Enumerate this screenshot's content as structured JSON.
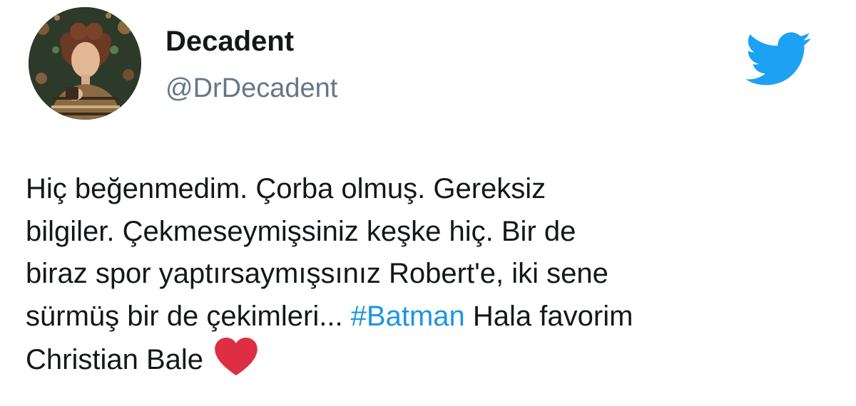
{
  "user": {
    "display_name": "Decadent",
    "handle": "@DrDecadent"
  },
  "icons": {
    "avatar": "profile-photo",
    "logo": "twitter-bird-icon",
    "emoji": "red-heart-icon"
  },
  "colors": {
    "text": "#14171a",
    "handle": "#657786",
    "hashtag": "#1b95e0",
    "twitter_blue": "#1da1f2",
    "heart": "#dd2e44"
  },
  "tweet": {
    "line1": "Hiç beğenmedim. Çorba olmuş. Gereksiz",
    "line2": "bilgiler. Çekmeseymişsiniz keşke hiç. Bir de",
    "line3": "biraz spor yaptırsaymışsınız Robert'e, iki sene",
    "line4_before": "sürmüş bir de çekimleri... ",
    "hashtag": "#Batman",
    "line4_after": " Hala favorim",
    "line5": "Christian Bale"
  }
}
